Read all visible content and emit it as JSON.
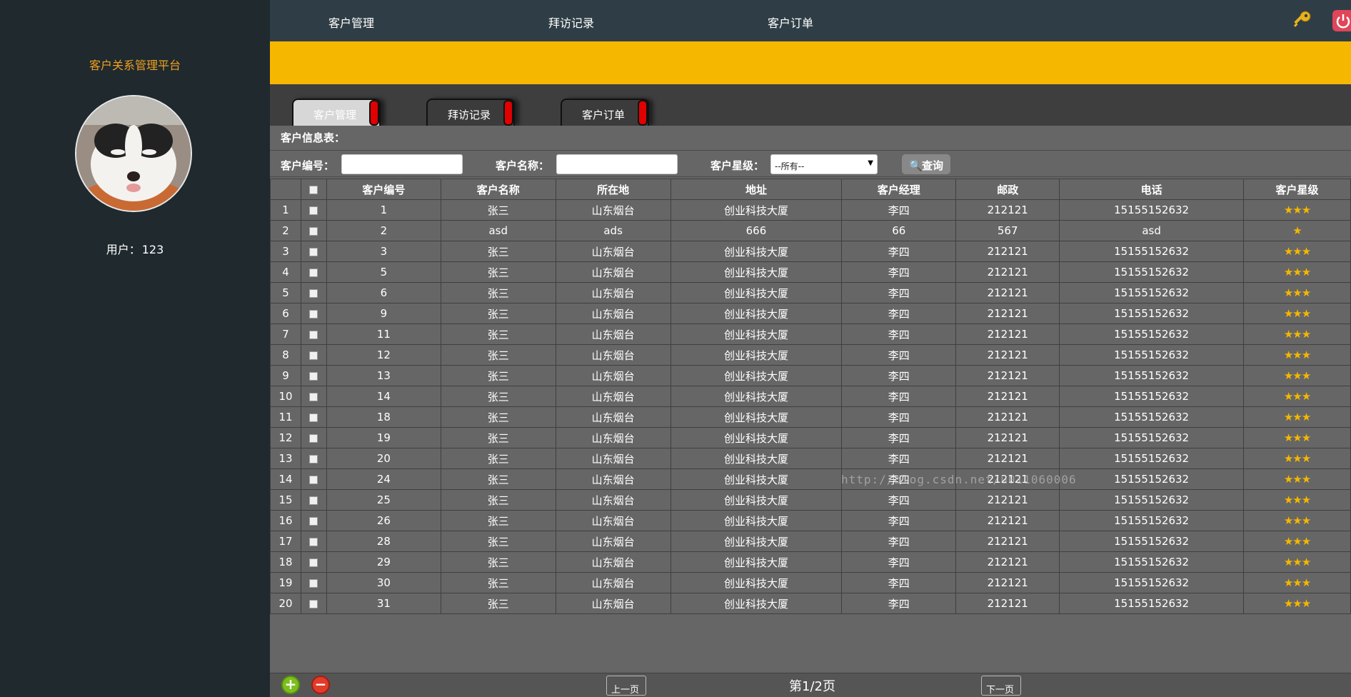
{
  "sidebar": {
    "brand": "客户关系管理平台",
    "user_label": "用户：",
    "user_name": "123"
  },
  "topnav": {
    "items": [
      "客户管理",
      "拜访记录",
      "客户订单"
    ],
    "icons": [
      "key-icon",
      "power-icon"
    ]
  },
  "tabs": [
    {
      "label": "客户管理",
      "active": true
    },
    {
      "label": "拜访记录",
      "active": false
    },
    {
      "label": "客户订单",
      "active": false
    }
  ],
  "main": {
    "section_title": "客户信息表：",
    "filters": {
      "id_label": "客户编号：",
      "id_value": "",
      "name_label": "客户名称：",
      "name_value": "",
      "level_label": "客户星级：",
      "level_selected": "--所有--",
      "query_label": "查询"
    },
    "table": {
      "headers": [
        "客户编号",
        "客户名称",
        "所在地",
        "地址",
        "客户经理",
        "邮政",
        "电话",
        "客户星级"
      ],
      "rows": [
        [
          "1",
          "1",
          "张三",
          "山东烟台",
          "创业科技大厦",
          "李四",
          "212121",
          "15155152632",
          "★★★"
        ],
        [
          "2",
          "2",
          "asd",
          "ads",
          "666",
          "66",
          "567",
          "asd",
          "★"
        ],
        [
          "3",
          "3",
          "张三",
          "山东烟台",
          "创业科技大厦",
          "李四",
          "212121",
          "15155152632",
          "★★★"
        ],
        [
          "4",
          "5",
          "张三",
          "山东烟台",
          "创业科技大厦",
          "李四",
          "212121",
          "15155152632",
          "★★★"
        ],
        [
          "5",
          "6",
          "张三",
          "山东烟台",
          "创业科技大厦",
          "李四",
          "212121",
          "15155152632",
          "★★★"
        ],
        [
          "6",
          "9",
          "张三",
          "山东烟台",
          "创业科技大厦",
          "李四",
          "212121",
          "15155152632",
          "★★★"
        ],
        [
          "7",
          "11",
          "张三",
          "山东烟台",
          "创业科技大厦",
          "李四",
          "212121",
          "15155152632",
          "★★★"
        ],
        [
          "8",
          "12",
          "张三",
          "山东烟台",
          "创业科技大厦",
          "李四",
          "212121",
          "15155152632",
          "★★★"
        ],
        [
          "9",
          "13",
          "张三",
          "山东烟台",
          "创业科技大厦",
          "李四",
          "212121",
          "15155152632",
          "★★★"
        ],
        [
          "10",
          "14",
          "张三",
          "山东烟台",
          "创业科技大厦",
          "李四",
          "212121",
          "15155152632",
          "★★★"
        ],
        [
          "11",
          "18",
          "张三",
          "山东烟台",
          "创业科技大厦",
          "李四",
          "212121",
          "15155152632",
          "★★★"
        ],
        [
          "12",
          "19",
          "张三",
          "山东烟台",
          "创业科技大厦",
          "李四",
          "212121",
          "15155152632",
          "★★★"
        ],
        [
          "13",
          "20",
          "张三",
          "山东烟台",
          "创业科技大厦",
          "李四",
          "212121",
          "15155152632",
          "★★★"
        ],
        [
          "14",
          "24",
          "张三",
          "山东烟台",
          "创业科技大厦",
          "李四",
          "212121",
          "15155152632",
          "★★★"
        ],
        [
          "15",
          "25",
          "张三",
          "山东烟台",
          "创业科技大厦",
          "李四",
          "212121",
          "15155152632",
          "★★★"
        ],
        [
          "16",
          "26",
          "张三",
          "山东烟台",
          "创业科技大厦",
          "李四",
          "212121",
          "15155152632",
          "★★★"
        ],
        [
          "17",
          "28",
          "张三",
          "山东烟台",
          "创业科技大厦",
          "李四",
          "212121",
          "15155152632",
          "★★★"
        ],
        [
          "18",
          "29",
          "张三",
          "山东烟台",
          "创业科技大厦",
          "李四",
          "212121",
          "15155152632",
          "★★★"
        ],
        [
          "19",
          "30",
          "张三",
          "山东烟台",
          "创业科技大厦",
          "李四",
          "212121",
          "15155152632",
          "★★★"
        ],
        [
          "20",
          "31",
          "张三",
          "山东烟台",
          "创业科技大厦",
          "李四",
          "212121",
          "15155152632",
          "★★★"
        ]
      ]
    },
    "watermark": "http://blog.csdn.net/u011060006"
  },
  "footer": {
    "prev_label": "上一页",
    "next_label": "下一页",
    "page_indicator": "第1/2页"
  },
  "colors": {
    "accent": "#f5b700",
    "brand_text": "#f0a020",
    "sidebar_bg": "#1f292e",
    "nav_bg": "#2f3e46",
    "content_bg": "#666666"
  }
}
